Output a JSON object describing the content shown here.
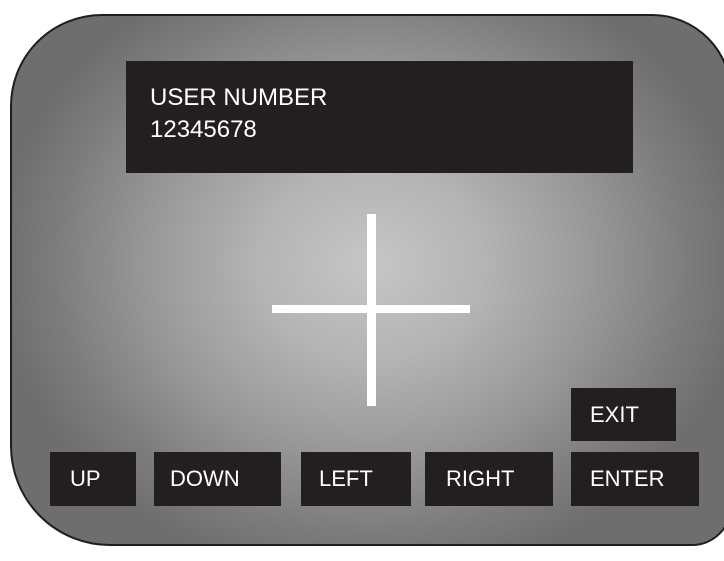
{
  "display": {
    "label": "USER NUMBER",
    "value": "12345678"
  },
  "buttons": {
    "exit": "EXIT",
    "up": "UP",
    "down": "DOWN",
    "left": "LEFT",
    "right": "RIGHT",
    "enter": "ENTER"
  },
  "colors": {
    "panel_center": "#c6c6c6",
    "panel_edge": "#6e6e6e",
    "button_bg": "#231f20",
    "text": "#ffffff",
    "crosshair": "#ffffff"
  },
  "icons": {
    "crosshair": "crosshair-icon"
  }
}
